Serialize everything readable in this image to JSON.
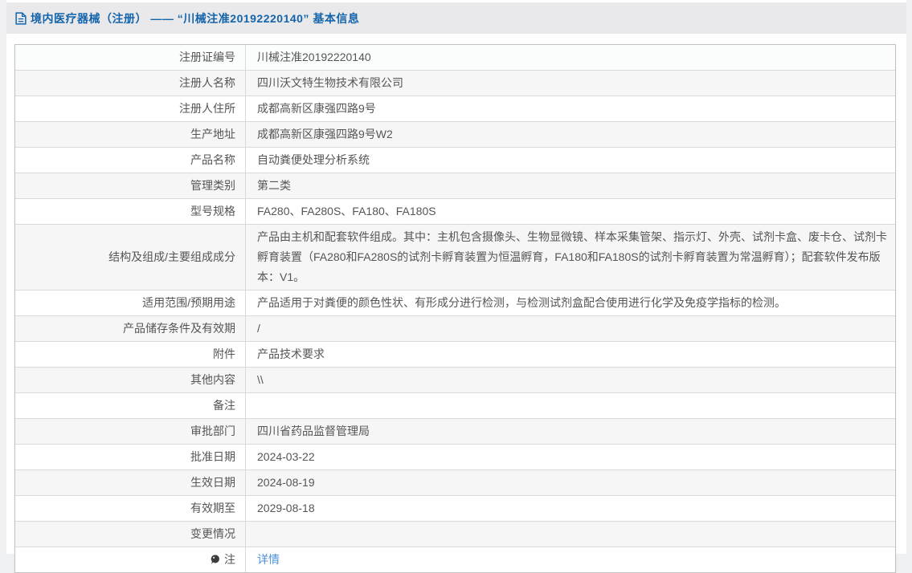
{
  "header": {
    "title": "境内医疗器械（注册） —— “川械注准20192220140” 基本信息"
  },
  "table": {
    "rows": [
      {
        "label": "注册证编号",
        "value": "川械注准20192220140"
      },
      {
        "label": "注册人名称",
        "value": "四川沃文特生物技术有限公司"
      },
      {
        "label": "注册人住所",
        "value": "成都高新区康强四路9号"
      },
      {
        "label": "生产地址",
        "value": "成都高新区康强四路9号W2"
      },
      {
        "label": "产品名称",
        "value": "自动粪便处理分析系统"
      },
      {
        "label": "管理类别",
        "value": "第二类"
      },
      {
        "label": "型号规格",
        "value": "FA280、FA280S、FA180、FA180S"
      },
      {
        "label": "结构及组成/主要组成成分",
        "value": "产品由主机和配套软件组成。其中：主机包含摄像头、生物显微镜、样本采集管架、指示灯、外壳、试剂卡盒、废卡仓、试剂卡孵育装置（FA280和FA280S的试剂卡孵育装置为恒温孵育，FA180和FA180S的试剂卡孵育装置为常温孵育）；配套软件发布版本：V1。"
      },
      {
        "label": "适用范围/预期用途",
        "value": "产品适用于对粪便的颜色性状、有形成分进行检测，与检测试剂盒配合使用进行化学及免疫学指标的检测。"
      },
      {
        "label": "产品储存条件及有效期",
        "value": "/"
      },
      {
        "label": "附件",
        "value": "产品技术要求"
      },
      {
        "label": "其他内容",
        "value": "\\\\"
      },
      {
        "label": "备注",
        "value": ""
      },
      {
        "label": "审批部门",
        "value": "四川省药品监督管理局"
      },
      {
        "label": "批准日期",
        "value": "2024-03-22"
      },
      {
        "label": "生效日期",
        "value": "2024-08-19"
      },
      {
        "label": "有效期至",
        "value": "2029-08-18"
      },
      {
        "label": "变更情况",
        "value": ""
      },
      {
        "label": "注",
        "value": "详情",
        "link": true,
        "label_icon": "note-bulb-icon"
      }
    ]
  },
  "colors": {
    "title_blue": "#1464ab",
    "link_blue": "#4a90d9",
    "header_strip_bg": "#e9e9eb",
    "page_bg": "#eef0f2",
    "row_stripe": "#f6f6f6",
    "table_border": "#c2c2c2",
    "text": "#555555"
  }
}
